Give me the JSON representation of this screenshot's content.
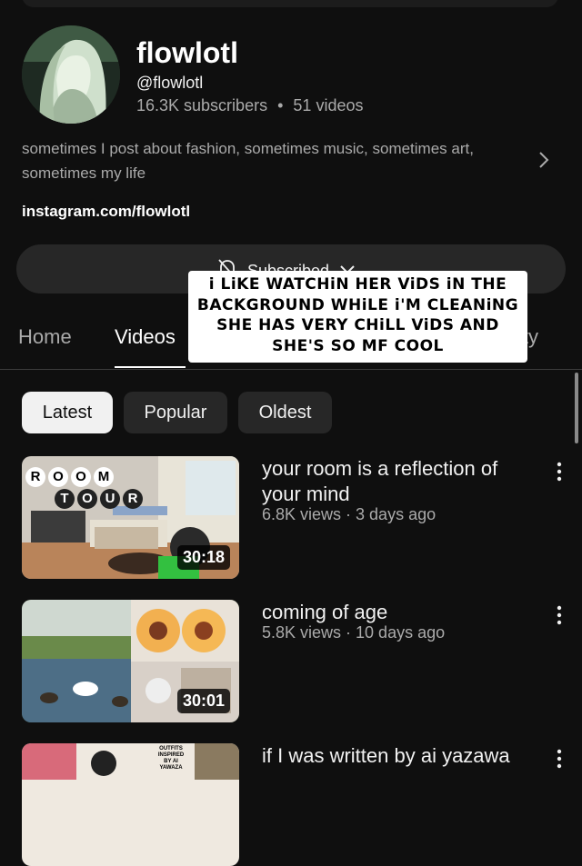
{
  "channel": {
    "name": "flowlotl",
    "handle": "@flowlotl",
    "subscribers": "16.3K subscribers",
    "separator": "•",
    "videos_count": "51 videos",
    "description": "sometimes I post about fashion, sometimes music, sometimes art, sometimes my life",
    "link": "instagram.com/flowlotl",
    "subscribe_label": "Subscribed"
  },
  "tabs": [
    {
      "label": "Home"
    },
    {
      "label": "Videos"
    },
    {
      "label": "ity"
    }
  ],
  "filters": [
    {
      "label": "Latest",
      "selected": true
    },
    {
      "label": "Popular",
      "selected": false
    },
    {
      "label": "Oldest",
      "selected": false
    }
  ],
  "videos": [
    {
      "title": "your room is a reflection of your mind",
      "meta": "6.8K views · 3 days ago",
      "duration": "30:18",
      "thumb_text": [
        "R",
        "O",
        "O",
        "M",
        "T",
        "O",
        "U",
        "R"
      ]
    },
    {
      "title": "coming of age",
      "meta": "5.8K views · 10 days ago",
      "duration": "30:01"
    },
    {
      "title": "if I was written by ai yazawa",
      "meta": "",
      "duration": "",
      "thumb_text": [
        "OUTFITS",
        "INSPIRED",
        "BY AI",
        "YAWAZA"
      ]
    }
  ],
  "overlay_caption": [
    "i LiKE WATCHiN HER ViDS iN THE",
    "BACKGROUND WHiLE i'M CLEANiNG",
    "SHE HAS VERY CHiLL ViDS AND",
    "SHE'S SO MF COOL"
  ],
  "colors": {
    "background": "#0f0f0f",
    "chip_selected": "#f1f1f1",
    "chip": "#272727",
    "secondary_text": "#aaaaaa"
  },
  "icons": {
    "description_more": "chevron-right-icon",
    "subscribe_bell": "bell-off-icon",
    "subscribe_menu": "chevron-down-icon",
    "video_menu": "more-vert-icon"
  }
}
